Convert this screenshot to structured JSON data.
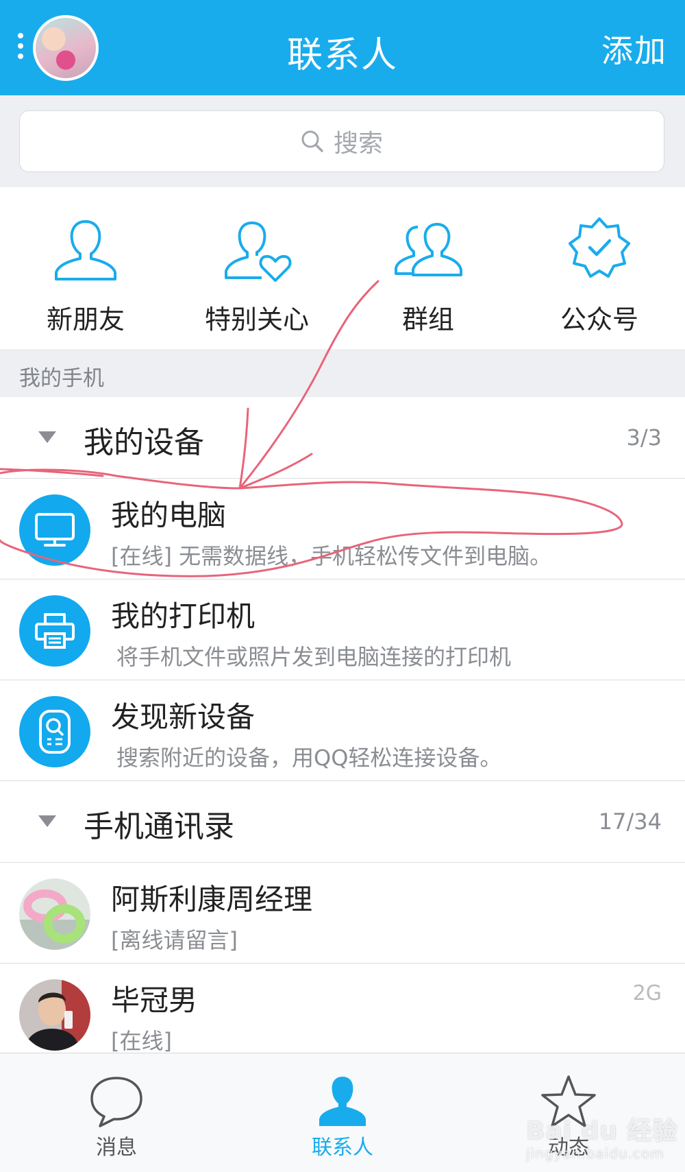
{
  "header": {
    "title": "联系人",
    "add_label": "添加"
  },
  "search": {
    "placeholder": "搜索"
  },
  "quick_entries": [
    {
      "label": "新朋友",
      "icon": "person-icon"
    },
    {
      "label": "特别关心",
      "icon": "person-heart-icon"
    },
    {
      "label": "群组",
      "icon": "group-icon"
    },
    {
      "label": "公众号",
      "icon": "verified-badge-icon"
    }
  ],
  "section_label": "我的手机",
  "groups": [
    {
      "name": "我的设备",
      "count": "3/3",
      "items": [
        {
          "title": "我的电脑",
          "subtitle": "[在线] 无需数据线，手机轻松传文件到电脑。",
          "icon": "monitor-icon"
        },
        {
          "title": "我的打印机",
          "subtitle": "将手机文件或照片发到电脑连接的打印机",
          "icon": "printer-icon"
        },
        {
          "title": "发现新设备",
          "subtitle": "搜索附近的设备，用QQ轻松连接设备。",
          "icon": "device-scan-icon"
        }
      ]
    },
    {
      "name": "手机通讯录",
      "count": "17/34",
      "items": [
        {
          "title": "阿斯利康周经理",
          "subtitle": "[离线请留言]",
          "side": ""
        },
        {
          "title": "毕冠男",
          "subtitle": "[在线]",
          "side": "2G"
        }
      ]
    }
  ],
  "tabs": [
    {
      "label": "消息",
      "icon": "chat-bubble-icon",
      "active": false
    },
    {
      "label": "联系人",
      "icon": "contacts-person-icon",
      "active": true
    },
    {
      "label": "动态",
      "icon": "star-icon",
      "active": false
    }
  ],
  "watermark": {
    "brand": "Bai du 经验",
    "url": "jingyan.baidu.com"
  },
  "colors": {
    "primary": "#19acec",
    "icon_blue": "#12a9ee",
    "annotation": "#e8647a"
  }
}
